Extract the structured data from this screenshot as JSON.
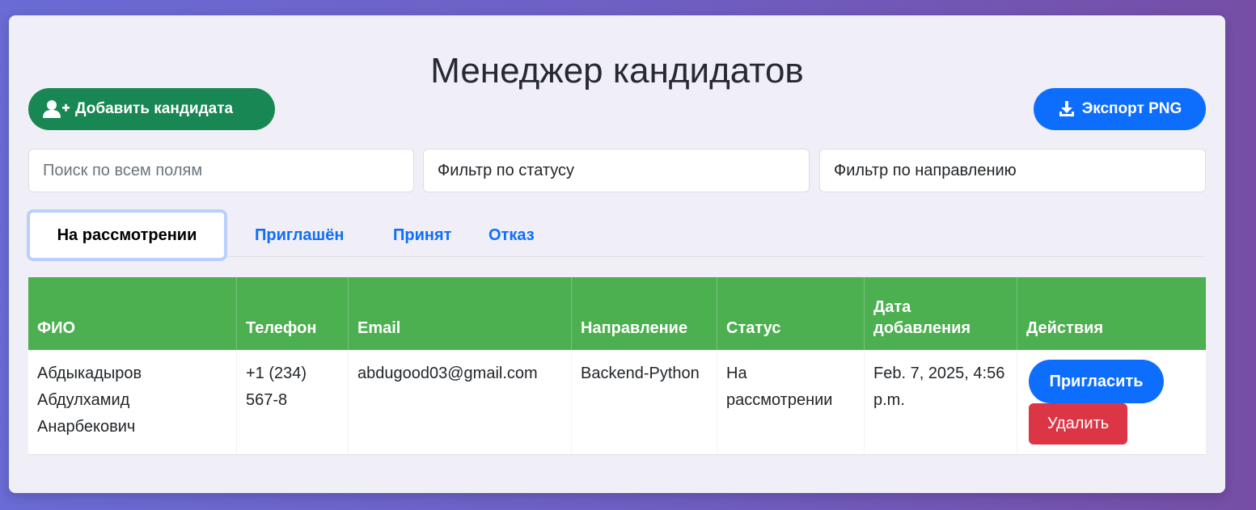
{
  "page": {
    "title": "Менеджер кандидатов"
  },
  "toolbar": {
    "add_label": "Добавить кандидата",
    "export_label": "Экспорт PNG"
  },
  "filters": {
    "search_placeholder": "Поиск по всем полям",
    "status_placeholder": "Фильтр по статусу",
    "direction_placeholder": "Фильтр по направлению"
  },
  "tabs": [
    {
      "label": "На рассмотрении",
      "active": true
    },
    {
      "label": "Приглашён",
      "active": false
    },
    {
      "label": "Принят",
      "active": false
    },
    {
      "label": "Отказ",
      "active": false
    }
  ],
  "table": {
    "columns": [
      "ФИО",
      "Телефон",
      "Email",
      "Направление",
      "Статус",
      "Дата добавления",
      "Действия"
    ],
    "rows": [
      {
        "name": "Абдыкадыров Абдулхамид Анарбекович",
        "phone": "+1 (234) 567-8",
        "email": "abdugood03@gmail.com",
        "direction": "Backend-Python",
        "status": "На рассмотрении",
        "date": "Feb. 7, 2025, 4:56 p.m.",
        "invite_label": "Пригласить",
        "delete_label": "Удалить"
      }
    ]
  },
  "icons": {
    "add": "user-plus-icon",
    "export": "download-icon"
  },
  "colors": {
    "success": "#198754",
    "primary": "#0d6efd",
    "danger": "#dc3545",
    "table_header": "#4caf50"
  }
}
